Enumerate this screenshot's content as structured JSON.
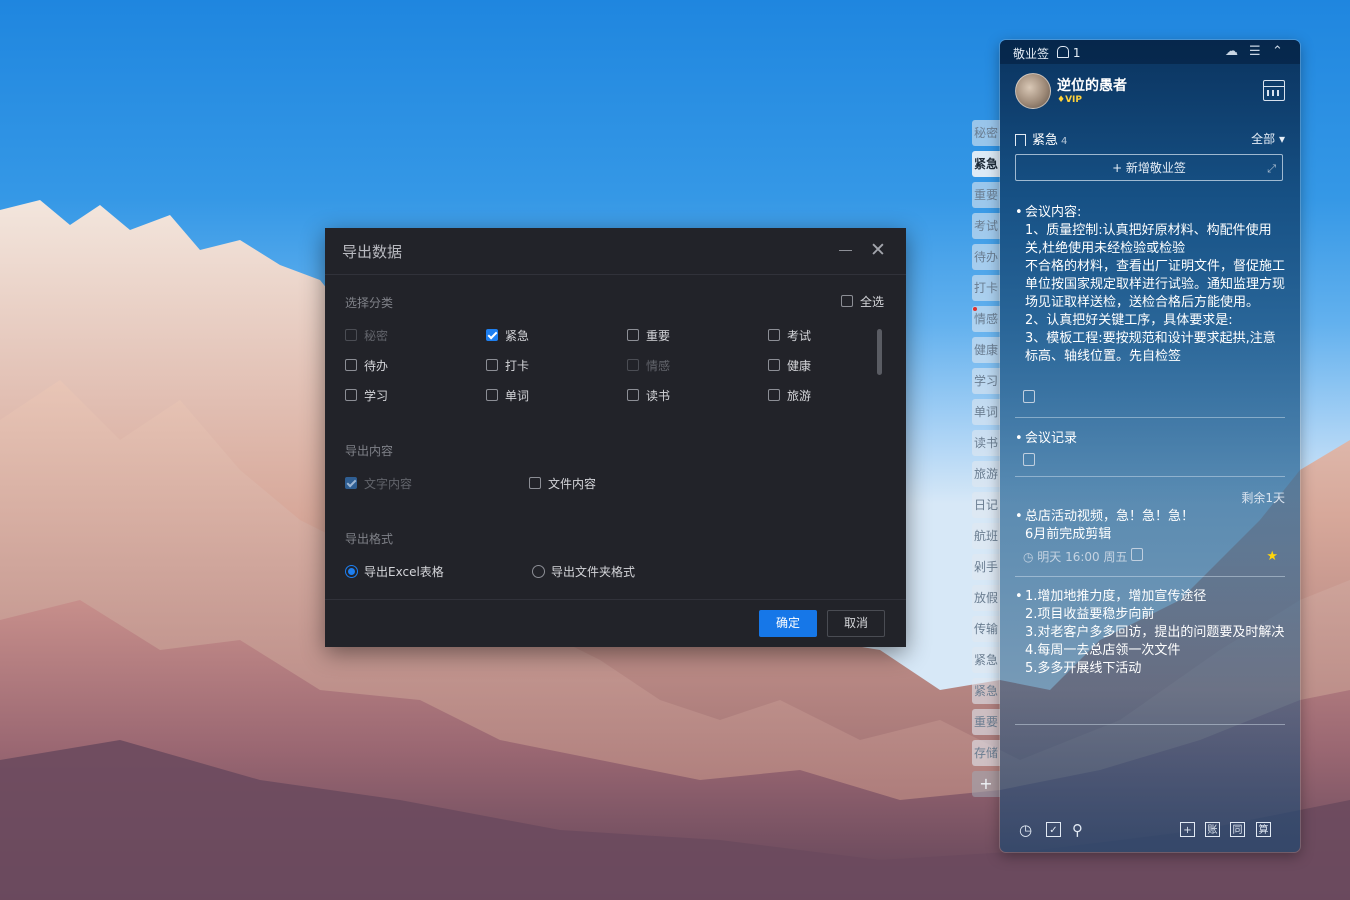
{
  "note": {
    "app_name": "敬业签",
    "notif_count": "1",
    "user": {
      "name": "逆位的愚者",
      "badge": "VIP"
    },
    "category": {
      "title": "紧急",
      "count": "4",
      "filter": "全部 ▾"
    },
    "add_label": "+ 新增敬业签",
    "items": [
      {
        "text": "会议内容:\n1、质量控制:认真把好原材料、构配件使用关,杜绝使用未经检验或检验\n不合格的材料，查看出厂证明文件，督促施工单位按国家规定取样进行试验。通知监理方现场见证取样送检，送检合格后方能使用。\n2、认真把好关键工序，具体要求是:\n3、模板工程:要按规范和设计要求起拱,注意标高、轴线位置。先自检签"
      },
      {
        "text": "会议记录"
      },
      {
        "remaining": "剩余1天",
        "text": "总店活动视频，急！急！急！\n6月前完成剪辑",
        "meta": "明天 16:00 周五"
      },
      {
        "text": "1.增加地推力度，增加宣传途径\n2.项目收益要稳步向前\n3.对老客户多多回访，提出的问题要及时解决\n4.每周一去总店领一次文件\n5.多多开展线下活动"
      }
    ],
    "side_tabs": [
      "秘密",
      "紧急",
      "重要",
      "考试",
      "待办",
      "打卡",
      "情感",
      "健康",
      "学习",
      "单词",
      "读书",
      "旅游",
      "日记",
      "航班",
      "剁手",
      "放假",
      "传输",
      "紧急",
      "紧急",
      "重要",
      "存储"
    ],
    "bottom_icons": [
      "clock-icon",
      "check-box-icon",
      "search-icon",
      "add-box-icon",
      "ledger-icon",
      "sync-icon",
      "calc-icon"
    ]
  },
  "dialog": {
    "title": "导出数据",
    "section_category": "选择分类",
    "select_all": "全选",
    "categories": [
      {
        "label": "秘密",
        "checked": false,
        "disabled": true
      },
      {
        "label": "紧急",
        "checked": true,
        "disabled": false
      },
      {
        "label": "重要",
        "checked": false,
        "disabled": false
      },
      {
        "label": "考试",
        "checked": false,
        "disabled": false
      },
      {
        "label": "待办",
        "checked": false,
        "disabled": false
      },
      {
        "label": "打卡",
        "checked": false,
        "disabled": false
      },
      {
        "label": "情感",
        "checked": false,
        "disabled": true
      },
      {
        "label": "健康",
        "checked": false,
        "disabled": false
      },
      {
        "label": "学习",
        "checked": false,
        "disabled": false
      },
      {
        "label": "单词",
        "checked": false,
        "disabled": false
      },
      {
        "label": "读书",
        "checked": false,
        "disabled": false
      },
      {
        "label": "旅游",
        "checked": false,
        "disabled": false
      }
    ],
    "section_content": "导出内容",
    "content_options": [
      {
        "label": "文字内容",
        "checked": true,
        "disabled": true
      },
      {
        "label": "文件内容",
        "checked": false,
        "disabled": false
      }
    ],
    "section_format": "导出格式",
    "format_options": [
      {
        "label": "导出Excel表格",
        "selected": true
      },
      {
        "label": "导出文件夹格式",
        "selected": false
      }
    ],
    "ok": "确定",
    "cancel": "取消"
  }
}
